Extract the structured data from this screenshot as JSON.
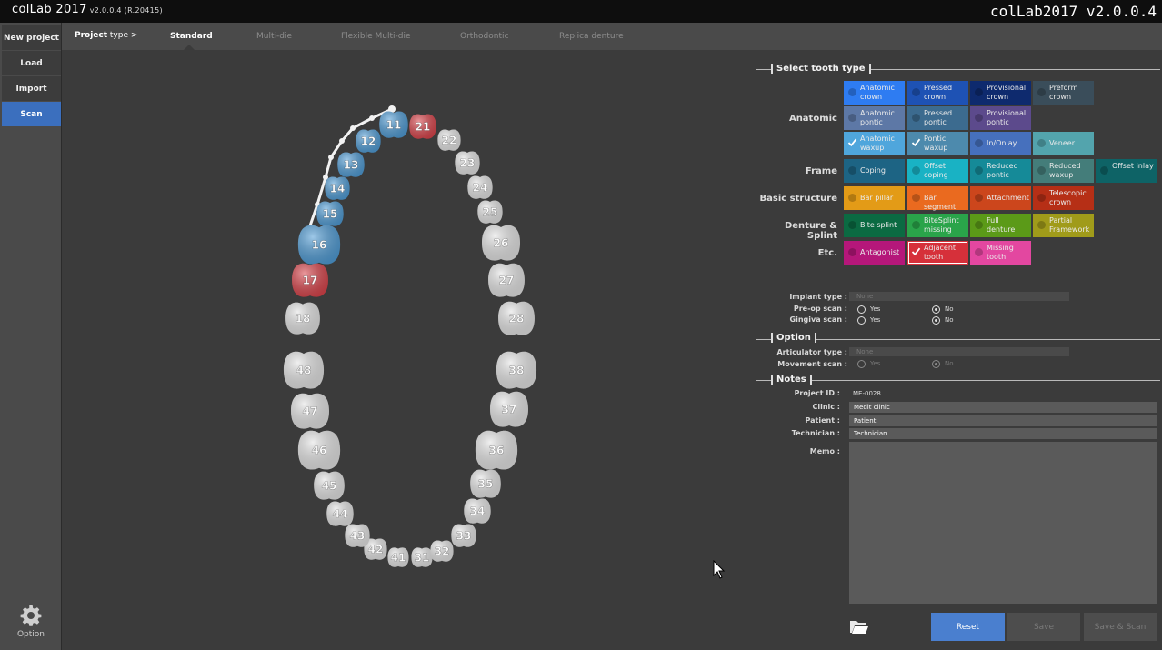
{
  "titlebar": {
    "brand": "colLab 2017",
    "version": "v2.0.0.4 (R.20415)",
    "title_right": "colLab2017 v2.0.0.4"
  },
  "sidebar": {
    "items": [
      {
        "label": "New project",
        "active": false
      },
      {
        "label": "Load",
        "active": false
      },
      {
        "label": "Import",
        "active": false
      },
      {
        "label": "Scan",
        "active": true
      }
    ],
    "option_label": "Option",
    "option_icon": "gear-icon"
  },
  "tabs": {
    "project_type_bold": "Project",
    "project_type_rest": " type >",
    "items": [
      {
        "label": "Standard",
        "active": true
      },
      {
        "label": "Multi-die",
        "active": false
      },
      {
        "label": "Flexible Multi-die",
        "active": false
      },
      {
        "label": "Orthodontic",
        "active": false
      },
      {
        "label": "Replica denture",
        "active": false
      }
    ]
  },
  "teeth": {
    "upper": [
      {
        "num": "11",
        "state": "selected"
      },
      {
        "num": "12",
        "state": "selected"
      },
      {
        "num": "13",
        "state": "selected"
      },
      {
        "num": "14",
        "state": "selected"
      },
      {
        "num": "15",
        "state": "selected"
      },
      {
        "num": "16",
        "state": "selected"
      },
      {
        "num": "17",
        "state": "adjacent"
      },
      {
        "num": "18",
        "state": "none"
      },
      {
        "num": "21",
        "state": "adjacent"
      },
      {
        "num": "22",
        "state": "none"
      },
      {
        "num": "23",
        "state": "none"
      },
      {
        "num": "24",
        "state": "none"
      },
      {
        "num": "25",
        "state": "none"
      },
      {
        "num": "26",
        "state": "none"
      },
      {
        "num": "27",
        "state": "none"
      },
      {
        "num": "28",
        "state": "none"
      }
    ],
    "lower": [
      {
        "num": "31",
        "state": "none"
      },
      {
        "num": "32",
        "state": "none"
      },
      {
        "num": "33",
        "state": "none"
      },
      {
        "num": "34",
        "state": "none"
      },
      {
        "num": "35",
        "state": "none"
      },
      {
        "num": "36",
        "state": "none"
      },
      {
        "num": "37",
        "state": "none"
      },
      {
        "num": "38",
        "state": "none"
      },
      {
        "num": "41",
        "state": "none"
      },
      {
        "num": "42",
        "state": "none"
      },
      {
        "num": "43",
        "state": "none"
      },
      {
        "num": "44",
        "state": "none"
      },
      {
        "num": "45",
        "state": "none"
      },
      {
        "num": "46",
        "state": "none"
      },
      {
        "num": "47",
        "state": "none"
      },
      {
        "num": "48",
        "state": "none"
      }
    ],
    "colors": {
      "selected": "#4f9cd6",
      "adjacent": "#d9434a",
      "none": "#e4e4e4"
    }
  },
  "tooth_type": {
    "title": "Select tooth type",
    "rows": [
      {
        "label": "Anatomic",
        "chips": [
          {
            "label": "Anatomic crown",
            "color": "#2e7cf2",
            "selected": false,
            "checked": false
          },
          {
            "label": "Pressed crown",
            "color": "#1e52b4",
            "selected": false,
            "checked": false
          },
          {
            "label": "Provisional crown",
            "color": "#0e2a6e",
            "selected": false,
            "checked": false
          },
          {
            "label": "Preform crown",
            "color": "#3a4d5a",
            "selected": false,
            "checked": false
          }
        ]
      },
      {
        "label": "",
        "chips": [
          {
            "label": "Anatomic pontic",
            "color": "#5d78a6",
            "selected": false,
            "checked": false
          },
          {
            "label": "Pressed pontic",
            "color": "#3c6b8f",
            "selected": false,
            "checked": false
          },
          {
            "label": "Provisional pontic",
            "color": "#5c4a8c",
            "selected": false,
            "checked": false
          }
        ]
      },
      {
        "label": "",
        "chips": [
          {
            "label": "Anatomic waxup",
            "color": "#4fa6dc",
            "selected": false,
            "checked": true
          },
          {
            "label": "Pontic waxup",
            "color": "#4d8aad",
            "selected": false,
            "checked": true
          },
          {
            "label": "In/Onlay",
            "color": "#4670bd",
            "selected": false,
            "checked": false
          },
          {
            "label": "Veneer",
            "color": "#53a4ad",
            "selected": false,
            "checked": false
          }
        ]
      },
      {
        "label": "Frame",
        "chips": [
          {
            "label": "Coping",
            "color": "#1d6484",
            "selected": false,
            "checked": false
          },
          {
            "label": "Offset coping",
            "color": "#19b2c4",
            "selected": false,
            "checked": false
          },
          {
            "label": "Reduced pontic",
            "color": "#158a98",
            "selected": false,
            "checked": false
          },
          {
            "label": "Reduced waxup",
            "color": "#447d7a",
            "selected": false,
            "checked": false
          },
          {
            "label": "Offset inlay",
            "color": "#0e6366",
            "selected": false,
            "checked": false
          }
        ]
      },
      {
        "label": "Basic structure",
        "chips": [
          {
            "label": "Bar pillar",
            "color": "#e39b17",
            "selected": false,
            "checked": false
          },
          {
            "label": "Bar segment",
            "color": "#ea6a1f",
            "selected": false,
            "checked": false
          },
          {
            "label": "Attachment",
            "color": "#cc461c",
            "selected": false,
            "checked": false
          },
          {
            "label": "Telescopic crown",
            "color": "#b62f16",
            "selected": false,
            "checked": false
          }
        ]
      },
      {
        "label": "Denture & Splint",
        "chips": [
          {
            "label": "Bite splint",
            "color": "#0b6a42",
            "selected": false,
            "checked": false
          },
          {
            "label": "BiteSplint missing",
            "color": "#2aa44a",
            "selected": false,
            "checked": false
          },
          {
            "label": "Full denture",
            "color": "#5b9a18",
            "selected": false,
            "checked": false
          },
          {
            "label": "Partial Framework",
            "color": "#a09b1a",
            "selected": false,
            "checked": false
          }
        ]
      },
      {
        "label": "Etc.",
        "chips": [
          {
            "label": "Antagonist",
            "color": "#b5177a",
            "selected": false,
            "checked": false
          },
          {
            "label": "Adjacent tooth",
            "color": "#d6303a",
            "selected": true,
            "checked": true
          },
          {
            "label": "Missing tooth",
            "color": "#e347a0",
            "selected": false,
            "checked": false
          }
        ]
      }
    ]
  },
  "scan_settings": {
    "implant_type_label": "Implant type :",
    "implant_type_value": "None",
    "preop_label": "Pre-op scan :",
    "gingiva_label": "Gingiva scan :",
    "yes": "Yes",
    "no": "No"
  },
  "option": {
    "title": "Option",
    "articulator_label": "Articulator type :",
    "articulator_value": "None",
    "movement_label": "Movement scan :"
  },
  "notes": {
    "title": "Notes",
    "project_id_label": "Project ID :",
    "project_id": "ME-0028",
    "clinic_label": "Clinic :",
    "clinic": "Medit clinic",
    "patient_label": "Patient :",
    "patient": "Patient",
    "technician_label": "Technician :",
    "technician": "Technician",
    "memo_label": "Memo :"
  },
  "actions": {
    "reset": "Reset",
    "save": "Save",
    "save_scan": "Save & Scan"
  }
}
